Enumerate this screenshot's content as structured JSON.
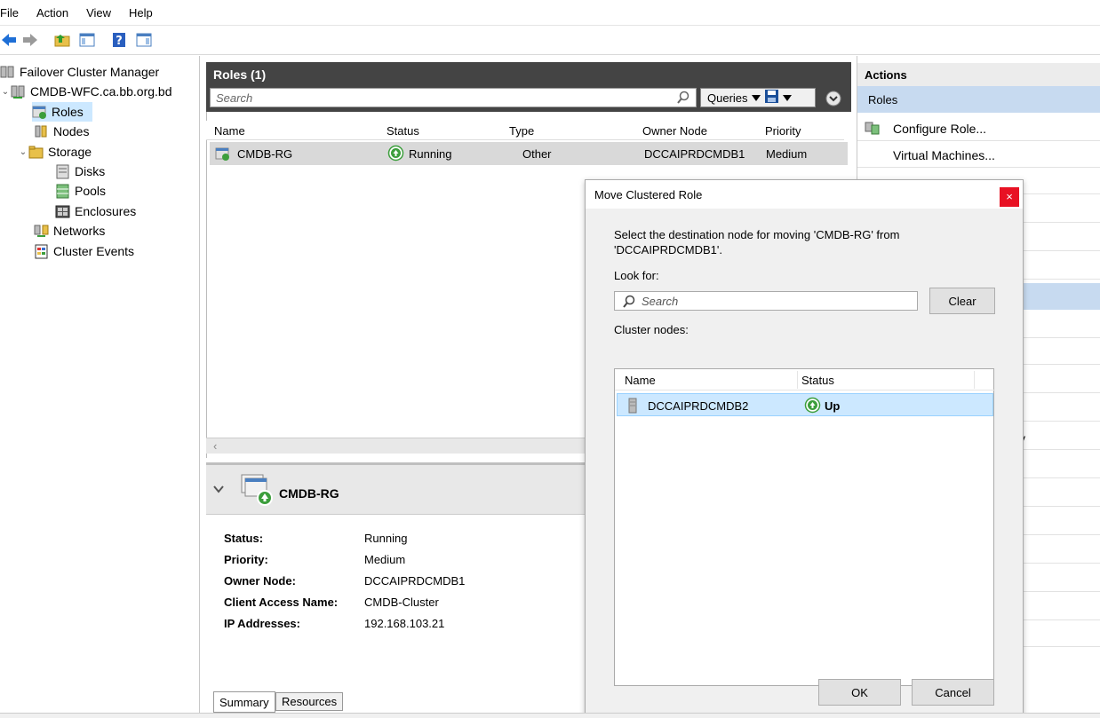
{
  "menu": {
    "file": "File",
    "action": "Action",
    "view": "View",
    "help": "Help"
  },
  "tree": {
    "root": "Failover Cluster Manager",
    "cluster": "CMDB-WFC.ca.bb.org.bd",
    "roles": "Roles",
    "nodes": "Nodes",
    "storage": "Storage",
    "disks": "Disks",
    "pools": "Pools",
    "enclosures": "Enclosures",
    "networks": "Networks",
    "events": "Cluster Events"
  },
  "roles_panel": {
    "title": "Roles (1)",
    "search_placeholder": "Search",
    "queries_label": "Queries",
    "columns": {
      "name": "Name",
      "status": "Status",
      "type": "Type",
      "owner": "Owner Node",
      "priority": "Priority"
    },
    "row": {
      "name": "CMDB-RG",
      "status": "Running",
      "type": "Other",
      "owner": "DCCAIPRDCMDB1",
      "priority": "Medium"
    }
  },
  "details": {
    "title": "CMDB-RG",
    "status_key": "Status:",
    "status_val": "Running",
    "priority_key": "Priority:",
    "priority_val": "Medium",
    "owner_key": "Owner Node:",
    "owner_val": "DCCAIPRDCMDB1",
    "client_key": "Client Access Name:",
    "client_val": "CMDB-Cluster",
    "ip_key": "IP Addresses:",
    "ip_val": "192.168.103.21",
    "tab_summary": "Summary",
    "tab_resources": "Resources"
  },
  "actions": {
    "header": "Actions",
    "section": "Roles",
    "configure": "Configure Role...",
    "vms": "Virtual Machines...",
    "partial_y": "y"
  },
  "dialog": {
    "title": "Move Clustered Role",
    "close": "×",
    "instruction": "Select the destination node for moving 'CMDB-RG' from 'DCCAIPRDCMDB1'.",
    "look_for": "Look for:",
    "search_placeholder": "Search",
    "clear": "Clear",
    "cluster_nodes": "Cluster nodes:",
    "col_name": "Name",
    "col_status": "Status",
    "node_name": "DCCAIPRDCMDB2",
    "node_status": "Up",
    "ok": "OK",
    "cancel": "Cancel"
  },
  "colors": {
    "selection": "#cce8ff",
    "header_dark": "#444444",
    "close_red": "#e81123",
    "status_green": "#3c9e3c"
  }
}
